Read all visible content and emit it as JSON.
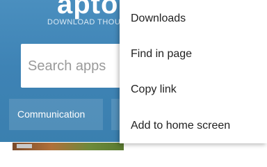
{
  "header": {
    "logo_text": "aptoide",
    "tagline": "DOWNLOAD THOUSANDS"
  },
  "search": {
    "placeholder": "Search apps"
  },
  "categories": [
    {
      "label": "Communication"
    },
    {
      "label": ""
    }
  ],
  "menu": {
    "items": [
      {
        "label": "Downloads"
      },
      {
        "label": "Find in page"
      },
      {
        "label": "Copy link"
      },
      {
        "label": "Add to home screen"
      }
    ]
  },
  "colors": {
    "header_blue": "#3e83b5",
    "menu_background": "#ffffff",
    "menu_text": "#212121"
  }
}
